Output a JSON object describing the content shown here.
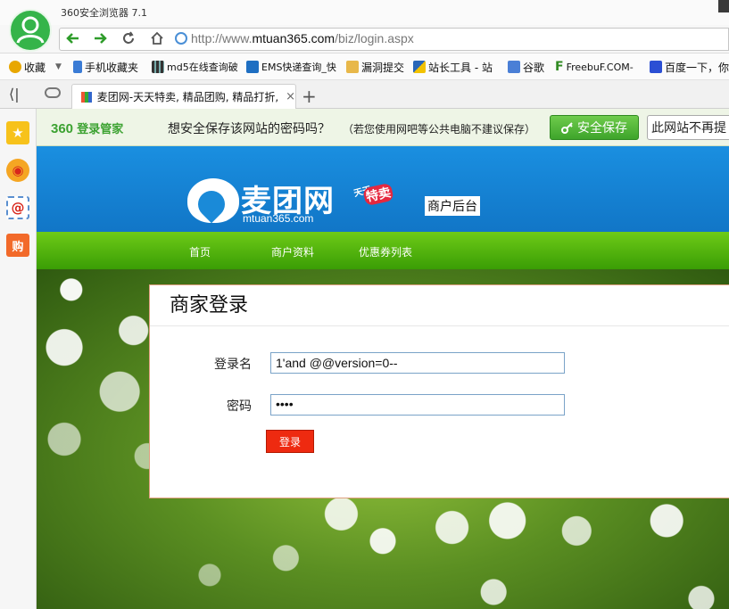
{
  "window": {
    "title": "360安全浏览器 7.1"
  },
  "address_bar": {
    "prefix": "http://www.",
    "host": "mtuan365.com",
    "path": "/biz/login.aspx"
  },
  "bookmarks": [
    {
      "label": "收藏",
      "icon": "star-add-icon",
      "color": "#e8a700"
    },
    {
      "label": "手机收藏夹",
      "icon": "phone-icon",
      "color": "#3a7bd5"
    },
    {
      "label": "md5在线查询破",
      "icon": "grid-icon",
      "color": "#444444"
    },
    {
      "label": "EMS快递查询_快",
      "icon": "ems-icon",
      "color": "#1f6fc2"
    },
    {
      "label": "漏洞提交",
      "icon": "folder-icon",
      "color": "#e8b84a"
    },
    {
      "label": "站长工具 - 站",
      "icon": "chinaz-icon",
      "color": "#2a67b8"
    },
    {
      "label": "谷歌",
      "icon": "google-icon",
      "color": "#4a7fd6"
    },
    {
      "label": "FreebuF.COM-",
      "icon": "freebuf-icon",
      "color": "#2f8a20"
    },
    {
      "label": "百度一下，你",
      "icon": "baidu-icon",
      "color": "#2b4fd4"
    }
  ],
  "tab": {
    "title": "麦团网-天天特卖, 精品团购, 精品打折,",
    "close": "×"
  },
  "new_tab": "+",
  "password_bar": {
    "brand": "360",
    "brand_sub": "登录管家",
    "question": "想安全保存该网站的密码吗？",
    "note": "（若您使用网吧等公共电脑不建议保存）",
    "save_label": "安全保存",
    "never_label": "此网站不再提"
  },
  "site": {
    "logo_name": "麦团网",
    "logo_domain": "mtuan365.com",
    "badge_top": "天天",
    "badge_main": "特卖",
    "merchant_tag": "商户后台",
    "menu": [
      "首页",
      "商户资料",
      "优惠券列表"
    ]
  },
  "login": {
    "title": "商家登录",
    "username_label": "登录名",
    "username_value": "1'and @@version=0--",
    "password_label": "密码",
    "password_value": "••••",
    "submit_label": "登录"
  },
  "colors": {
    "header_blue": "#1a8fe0",
    "menu_green": "#4fb10a",
    "save_green": "#4fb634",
    "login_red": "#ee2a10"
  }
}
